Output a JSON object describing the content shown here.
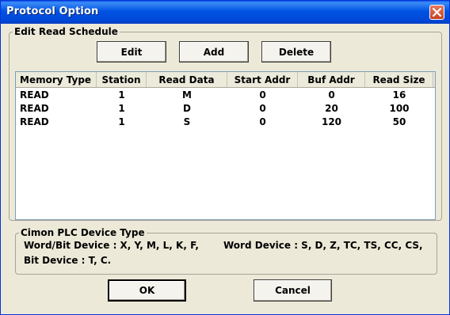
{
  "window": {
    "title": "Protocol Option"
  },
  "schedule": {
    "group_label": "Edit Read Schedule",
    "buttons": {
      "edit": "Edit",
      "add": "Add",
      "delete": "Delete"
    },
    "columns": [
      "Memory Type",
      "Station",
      "Read Data",
      "Start Addr",
      "Buf Addr",
      "Read Size"
    ],
    "rows": [
      [
        "READ",
        "1",
        "M",
        "0",
        "0",
        "16"
      ],
      [
        "READ",
        "1",
        "D",
        "0",
        "20",
        "100"
      ],
      [
        "READ",
        "1",
        "S",
        "0",
        "120",
        "50"
      ]
    ]
  },
  "device": {
    "group_label": "Cimon PLC Device Type",
    "word_bit": "Word/Bit Device : X, Y, M, L, K, F,",
    "word": "Word Device : S, D, Z, TC, TS, CC, CS,",
    "bit": "Bit Device : T, C."
  },
  "footer": {
    "ok": "OK",
    "cancel": "Cancel"
  },
  "icons": {
    "close": "close-icon"
  },
  "colors": {
    "titlebar": "#0054e3",
    "face": "#ece9d8",
    "close": "#c6411f"
  }
}
